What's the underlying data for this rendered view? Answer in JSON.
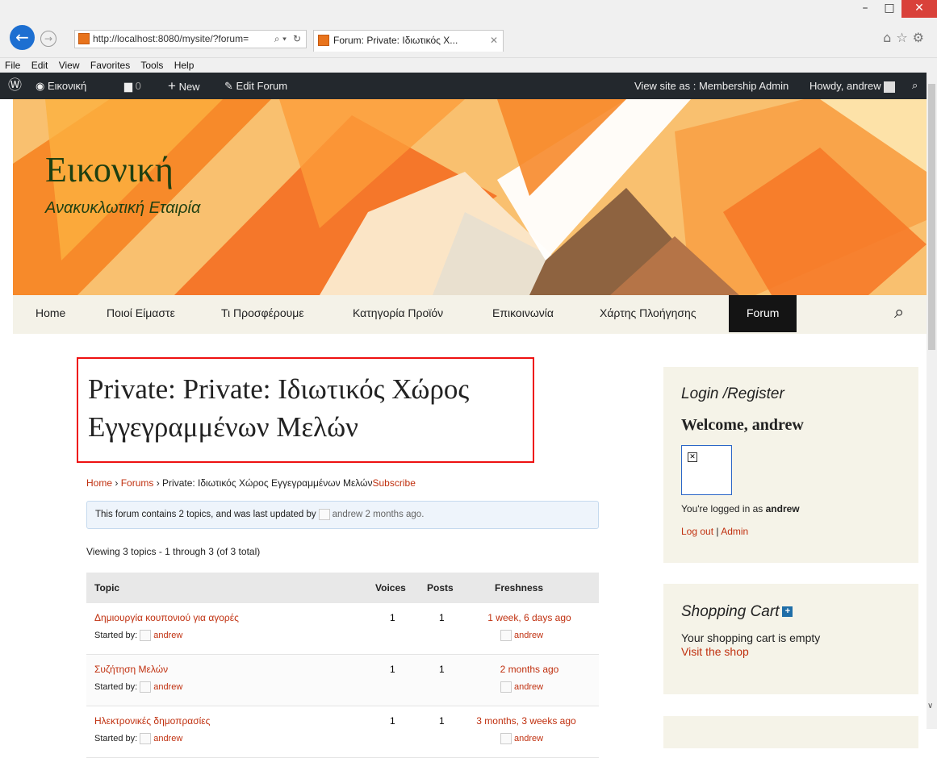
{
  "browser": {
    "address": "http://localhost:8080/mysite/?forum=",
    "tab_title": "Forum: Private: Ιδιωτικός Χ...",
    "menu": [
      "File",
      "Edit",
      "View",
      "Favorites",
      "Tools",
      "Help"
    ],
    "window_min": "–",
    "window_max": "□",
    "window_close": "✕"
  },
  "adminbar": {
    "site_name": "Εικονική",
    "comments_count": "0",
    "new_label": "New",
    "edit_forum": "Edit Forum",
    "view_as": "View site as : Membership Admin",
    "howdy": "Howdy, andrew"
  },
  "site": {
    "title": "Εικονική",
    "description": "Ανακυκλωτική Εταιρία"
  },
  "nav": {
    "items": [
      "Home",
      "Ποιοί Είμαστε",
      "Τι Προσφέρουμε",
      "Κατηγορία Προϊόν",
      "Επικοινωνία",
      "Χάρτης Πλοήγησης",
      "Forum"
    ],
    "active": "Forum"
  },
  "forum": {
    "title": "Private: Private: Ιδιωτικός Χώρος Εγγεγραμμένων Μελών",
    "breadcrumb": {
      "home": "Home",
      "sep": " › ",
      "forums": "Forums",
      "current": "Private: Ιδιωτικός Χώρος Εγγεγραμμένων Μελών",
      "subscribe": "Subscribe"
    },
    "notice_prefix": "This forum contains 2 topics, and was last updated by",
    "notice_user": "andrew",
    "notice_time": "2 months ago.",
    "viewing": "Viewing 3 topics - 1 through 3 (of 3 total)",
    "columns": {
      "topic": "Topic",
      "voices": "Voices",
      "posts": "Posts",
      "freshness": "Freshness"
    },
    "started_by": "Started by:",
    "topics": [
      {
        "title": "Δημιουργία κουπονιού για αγορές",
        "author": "andrew",
        "voices": "1",
        "posts": "1",
        "freshness": "1 week, 6 days ago",
        "last_user": "andrew"
      },
      {
        "title": "Συζήτηση Μελών",
        "author": "andrew",
        "voices": "1",
        "posts": "1",
        "freshness": "2 months ago",
        "last_user": "andrew"
      },
      {
        "title": "Ηλεκτρονικές δημοπρασίες",
        "author": "andrew",
        "voices": "1",
        "posts": "1",
        "freshness": "3 months, 3 weeks ago",
        "last_user": "andrew"
      }
    ]
  },
  "sidebar": {
    "login_title": "Login /Register",
    "welcome": "Welcome, andrew",
    "logged_prefix": "You're logged in as",
    "logged_user": "andrew",
    "logout": "Log out",
    "sep": "|",
    "admin": "Admin",
    "cart_title": "Shopping Cart",
    "cart_empty": "Your shopping cart is empty",
    "visit_shop": "Visit the shop"
  },
  "colors": {
    "accent": "#c0300f",
    "adminbar": "#23282d",
    "nav_active": "#141414",
    "title_box": "#e11111"
  }
}
